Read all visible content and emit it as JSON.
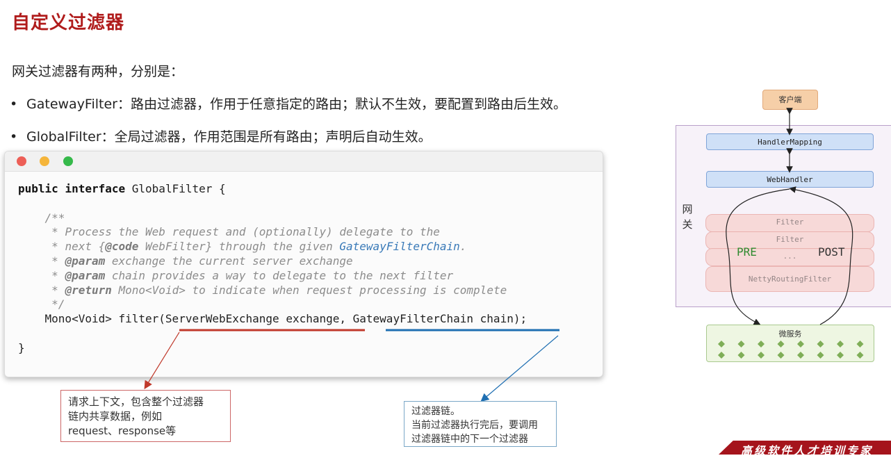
{
  "page": {
    "title": "自定义过滤器",
    "intro": "网关过滤器有两种，分别是：",
    "bullets": [
      {
        "dot": "•",
        "text": "GatewayFilter：路由过滤器，作用于任意指定的路由；默认不生效，要配置到路由后生效。"
      },
      {
        "dot": "•",
        "text": "GlobalFilter：全局过滤器，作用范围是所有路由；声明后自动生效。"
      }
    ]
  },
  "code": {
    "kw_public": "public",
    "kw_interface": "interface",
    "decl_rest": " GlobalFilter {",
    "doc_open": "/**",
    "doc_l1": "* Process the Web request and (optionally) delegate to the",
    "doc_l2_a": "* next {",
    "doc_l2_code": "@code",
    "doc_l2_b": " WebFilter} through the given ",
    "doc_l2_link": "GatewayFilterChain",
    "doc_l2_c": ".",
    "doc_l3_a": "* ",
    "doc_l3_tag": "@param",
    "doc_l3_b": " exchange the current server exchange",
    "doc_l4_a": "* ",
    "doc_l4_tag": "@param",
    "doc_l4_b": " chain provides a way to delegate to the next filter",
    "doc_l5_a": "* ",
    "doc_l5_tag": "@return",
    "doc_l5_b": " Mono<Void> to indicate when request processing is complete",
    "doc_close": "*/",
    "method": "Mono<Void> filter(ServerWebExchange exchange, GatewayFilterChain chain);",
    "close_brace": "}"
  },
  "callouts": {
    "exchange": [
      "请求上下文，包含整个过滤器",
      "链内共享数据，例如",
      "request、response等"
    ],
    "chain": [
      "过滤器链。",
      "当前过滤器执行完后，要调用",
      "过滤器链中的下一个过滤器"
    ]
  },
  "diagram": {
    "client": "客户端",
    "gateway_label": "网关",
    "handler_mapping": "HandlerMapping",
    "web_handler": "WebHandler",
    "filter1": "Filter",
    "filter2": "Filter",
    "filter3": "...",
    "filter4": "NettyRoutingFilter",
    "pre": "PRE",
    "post": "POST",
    "microservice": "微服务"
  },
  "banner": "高级软件人才培训专家",
  "colors": {
    "title": "#b01c1c",
    "underline_exchange": "#c0392b",
    "underline_chain": "#1f6fb2",
    "banner": "#a5141c"
  }
}
